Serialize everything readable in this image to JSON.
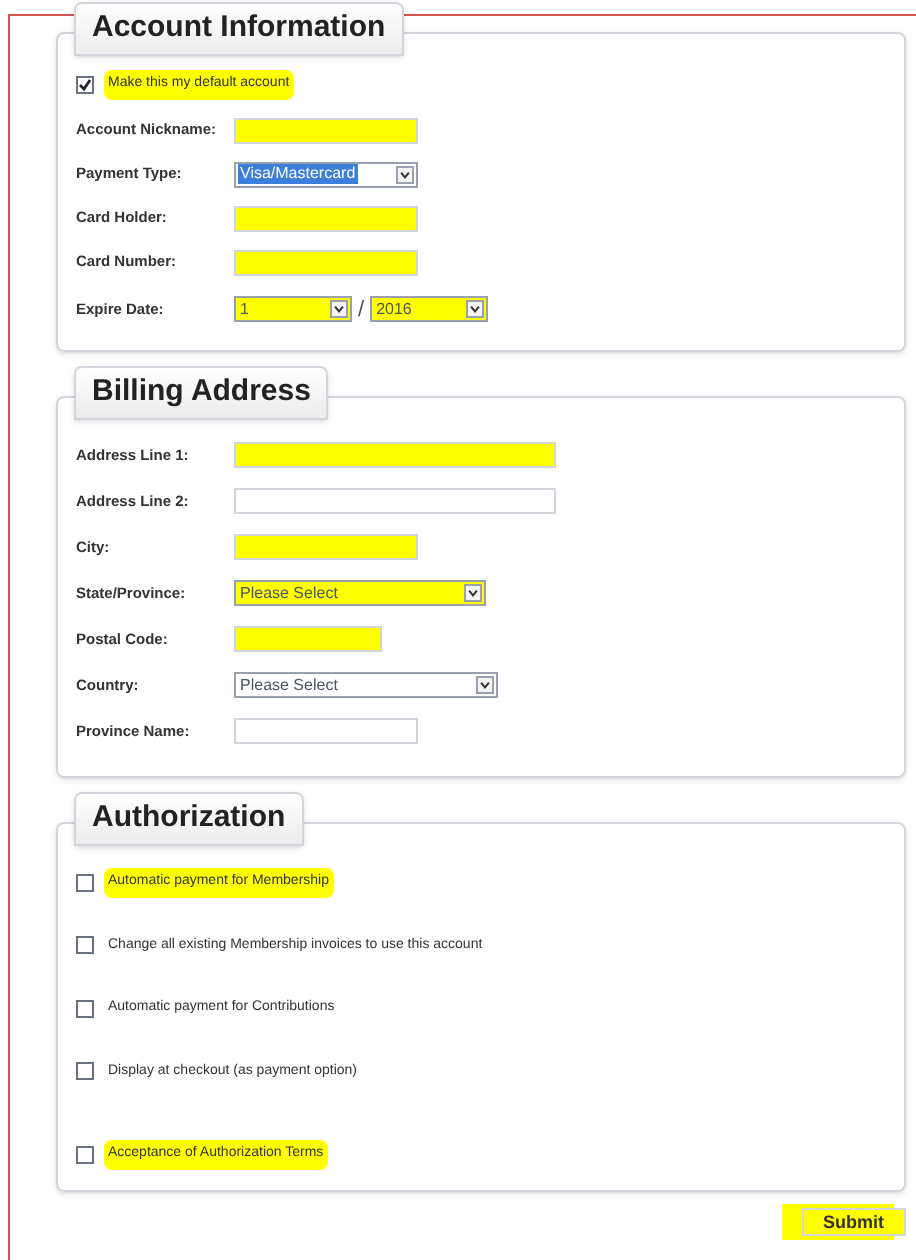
{
  "sections": [
    {
      "title": "Account Information",
      "rows": [
        {
          "kind": "checkbox",
          "label": "Make this my default account",
          "checked": true,
          "highlighted": true
        },
        {
          "kind": "text",
          "label": "Account Nickname:",
          "highlighted": true
        },
        {
          "kind": "select",
          "label": "Payment Type:",
          "value": "Visa/Mastercard",
          "focused": true,
          "highlighted": false
        },
        {
          "kind": "text",
          "label": "Card Holder:",
          "highlighted": true
        },
        {
          "kind": "text",
          "label": "Card Number:",
          "highlighted": true
        },
        {
          "kind": "date",
          "label": "Expire Date:",
          "month": "1",
          "separator": "/",
          "year": "2016",
          "highlighted": true
        }
      ]
    },
    {
      "title": "Billing Address",
      "rows": [
        {
          "kind": "text",
          "label": "Address Line 1:",
          "highlighted": true
        },
        {
          "kind": "text",
          "label": "Address Line 2:",
          "highlighted": false
        },
        {
          "kind": "text",
          "label": "City:",
          "highlighted": true
        },
        {
          "kind": "select",
          "label": "State/Province:",
          "value": "Please Select",
          "focused": false,
          "highlighted": true
        },
        {
          "kind": "text",
          "label": "Postal Code:",
          "highlighted": true
        },
        {
          "kind": "select",
          "label": "Country:",
          "value": "Please Select",
          "focused": false,
          "highlighted": false
        },
        {
          "kind": "text",
          "label": "Province Name:",
          "highlighted": false
        }
      ]
    },
    {
      "title": "Authorization",
      "rows": [
        {
          "kind": "checkbox",
          "label": "Automatic payment for Membership",
          "checked": false,
          "highlighted": true
        },
        {
          "kind": "checkbox",
          "label": "Change all existing Membership invoices to use this account",
          "checked": false,
          "highlighted": false
        },
        {
          "kind": "checkbox",
          "label": "Automatic payment for Contributions",
          "checked": false,
          "highlighted": false
        },
        {
          "kind": "checkbox",
          "label": "Display at checkout (as payment option)",
          "checked": false,
          "highlighted": false
        },
        {
          "kind": "checkbox",
          "label": "Acceptance of Authorization Terms",
          "checked": false,
          "highlighted": true
        }
      ]
    }
  ],
  "submit": {
    "label": "Submit",
    "highlighted": true
  }
}
